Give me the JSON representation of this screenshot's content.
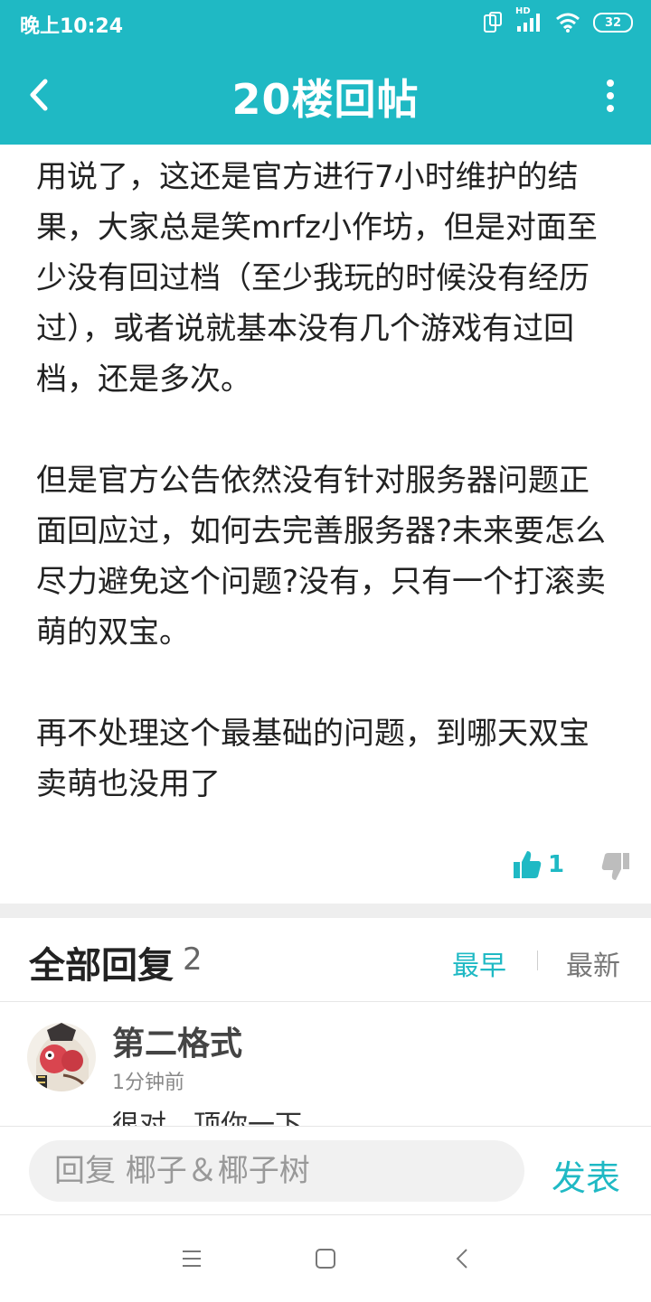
{
  "status_bar": {
    "time": "晚上10:24",
    "battery": "32",
    "network": "HD"
  },
  "header": {
    "title": "20楼回帖"
  },
  "post": {
    "paragraphs": [
      "用说了，这还是官方进行7小时维护的结果，大家总是笑mrfz小作坊，但是对面至少没有回过档（至少我玩的时候没有经历过），或者说就基本没有几个游戏有过回档，还是多次。",
      "但是官方公告依然没有针对服务器问题正面回应过，如何去完善服务器?未来要怎么尽力避免这个问题?没有，只有一个打滚卖萌的双宝。",
      "再不处理这个最基础的问题，到哪天双宝卖萌也没用了"
    ],
    "like_count": "1"
  },
  "replies": {
    "title": "全部回复",
    "count": "2",
    "sort_earliest": "最早",
    "sort_latest": "最新",
    "items": [
      {
        "user": "第二格式",
        "time": "1分钟前",
        "preview": "很对，顶你一下"
      }
    ]
  },
  "reply_box": {
    "placeholder": "回复 椰子＆椰子树",
    "post_label": "发表"
  },
  "colors": {
    "accent": "#1fb9c4"
  }
}
